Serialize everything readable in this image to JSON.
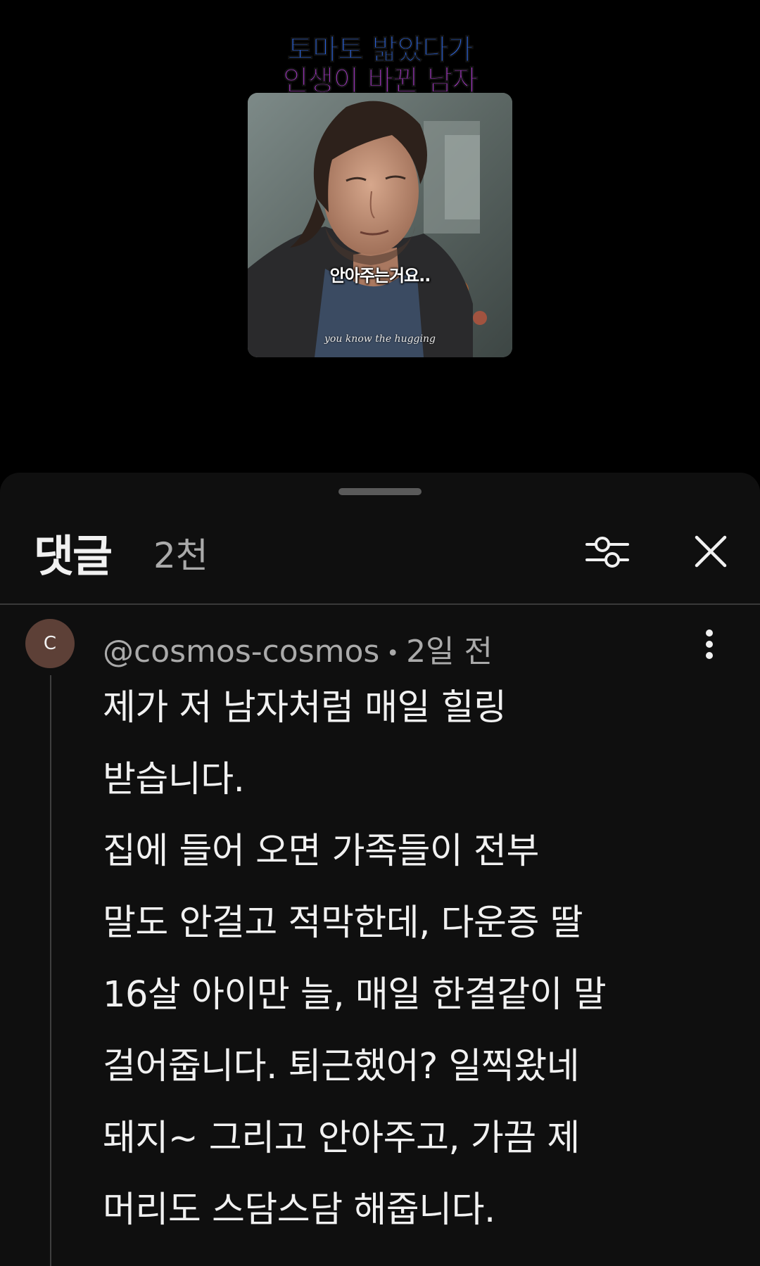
{
  "video": {
    "title_line1": "토마토 밟았다가",
    "title_line2": "인생이 바뀐 남자",
    "subtitle_ko": "안아주는거요..",
    "subtitle_en": "you know the hugging",
    "colors": {
      "title_line1": "#2f6df0",
      "title_line2": "#b43bd6"
    }
  },
  "comments_sheet": {
    "title": "댓글",
    "count": "2천",
    "filter_icon": "sliders-icon",
    "close_icon": "close-icon"
  },
  "comment": {
    "avatar_initial": "C",
    "avatar_color": "#5d4037",
    "author": "@cosmos-cosmos",
    "separator": "•",
    "time": "2일 전",
    "more_icon": "more-vert-icon",
    "lines": [
      "제가 저 남자처럼 매일 힐링",
      "받습니다.",
      "집에 들어 오면 가족들이 전부",
      "말도 안걸고 적막한데, 다운증 딸",
      "16살 아이만 늘, 매일 한결같이 말",
      "걸어줍니다. 퇴근했어? 일찍왔네",
      "돼지~ 그리고 안아주고, 가끔 제",
      "머리도 스담스담 해줍니다."
    ]
  }
}
